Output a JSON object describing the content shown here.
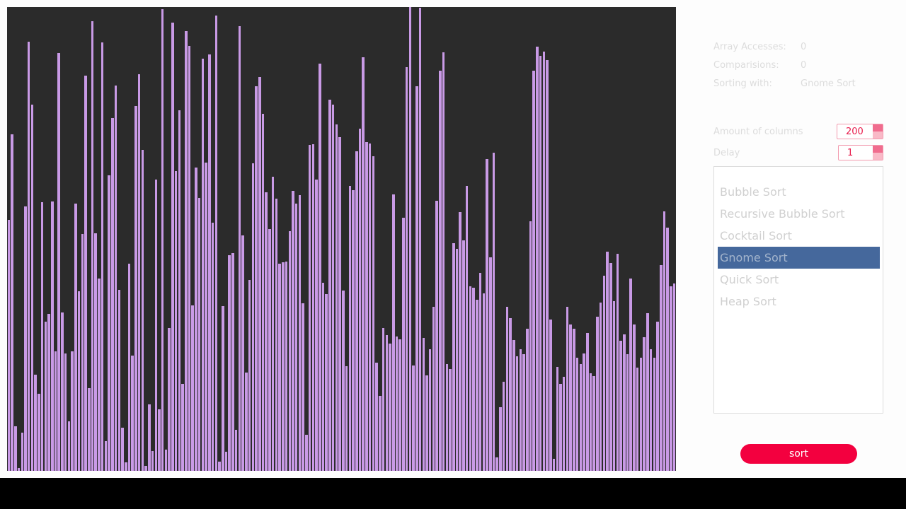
{
  "stats": {
    "array_accesses_label": "Array Accesses:",
    "array_accesses_value": "0",
    "comparisons_label": "Comparisions:",
    "comparisons_value": "0",
    "sorting_with_label": "Sorting with:",
    "sorting_with_value": "Gnome Sort"
  },
  "controls": {
    "columns_label": "Amount of columns",
    "columns_value": "200",
    "delay_label": "Delay",
    "delay_value": "1"
  },
  "algorithms": [
    "Bubble Sort",
    "Recursive Bubble Sort",
    "Cocktail Sort",
    "Gnome Sort",
    "Quick Sort",
    "Heap Sort"
  ],
  "selected_algorithm_index": 3,
  "sort_button_label": "sort",
  "colors": {
    "bar": "#c99ae6",
    "canvas": "#2b2b2b",
    "accent": "#f3003f",
    "selected": "#45689c"
  },
  "bars_max": 656,
  "bars": [
    355,
    476,
    63,
    4,
    54,
    374,
    607,
    518,
    136,
    109,
    380,
    211,
    222,
    381,
    169,
    591,
    224,
    166,
    70,
    169,
    378,
    254,
    335,
    559,
    117,
    636,
    336,
    272,
    606,
    42,
    418,
    499,
    545,
    256,
    61,
    12,
    293,
    163,
    516,
    561,
    454,
    7,
    94,
    28,
    412,
    87,
    653,
    30,
    202,
    634,
    424,
    510,
    123,
    622,
    601,
    234,
    429,
    386,
    583,
    436,
    589,
    351,
    644,
    13,
    233,
    27,
    305,
    308,
    58,
    629,
    333,
    139,
    270,
    435,
    544,
    557,
    505,
    394,
    342,
    416,
    385,
    293,
    295,
    296,
    339,
    396,
    378,
    390,
    237,
    51,
    461,
    462,
    412,
    576,
    266,
    250,
    525,
    518,
    490,
    472,
    255,
    148,
    403,
    397,
    452,
    484,
    585,
    465,
    463,
    445,
    153,
    106,
    202,
    192,
    180,
    391,
    190,
    186,
    358,
    571,
    656,
    149,
    544,
    655,
    188,
    135,
    172,
    232,
    382,
    566,
    592,
    151,
    144,
    322,
    314,
    366,
    326,
    403,
    261,
    259,
    242,
    280,
    251,
    441,
    302,
    450,
    19,
    90,
    126,
    232,
    216,
    185,
    162,
    172,
    165,
    201,
    353,
    566,
    600,
    587,
    593,
    581,
    214,
    17,
    147,
    123,
    133,
    232,
    207,
    201,
    160,
    151,
    166,
    195,
    138,
    134,
    218,
    238,
    276,
    310,
    294,
    240,
    307,
    184,
    193,
    165,
    272,
    207,
    146,
    160,
    189,
    223,
    172,
    160,
    211,
    291,
    367,
    344,
    261,
    265
  ]
}
